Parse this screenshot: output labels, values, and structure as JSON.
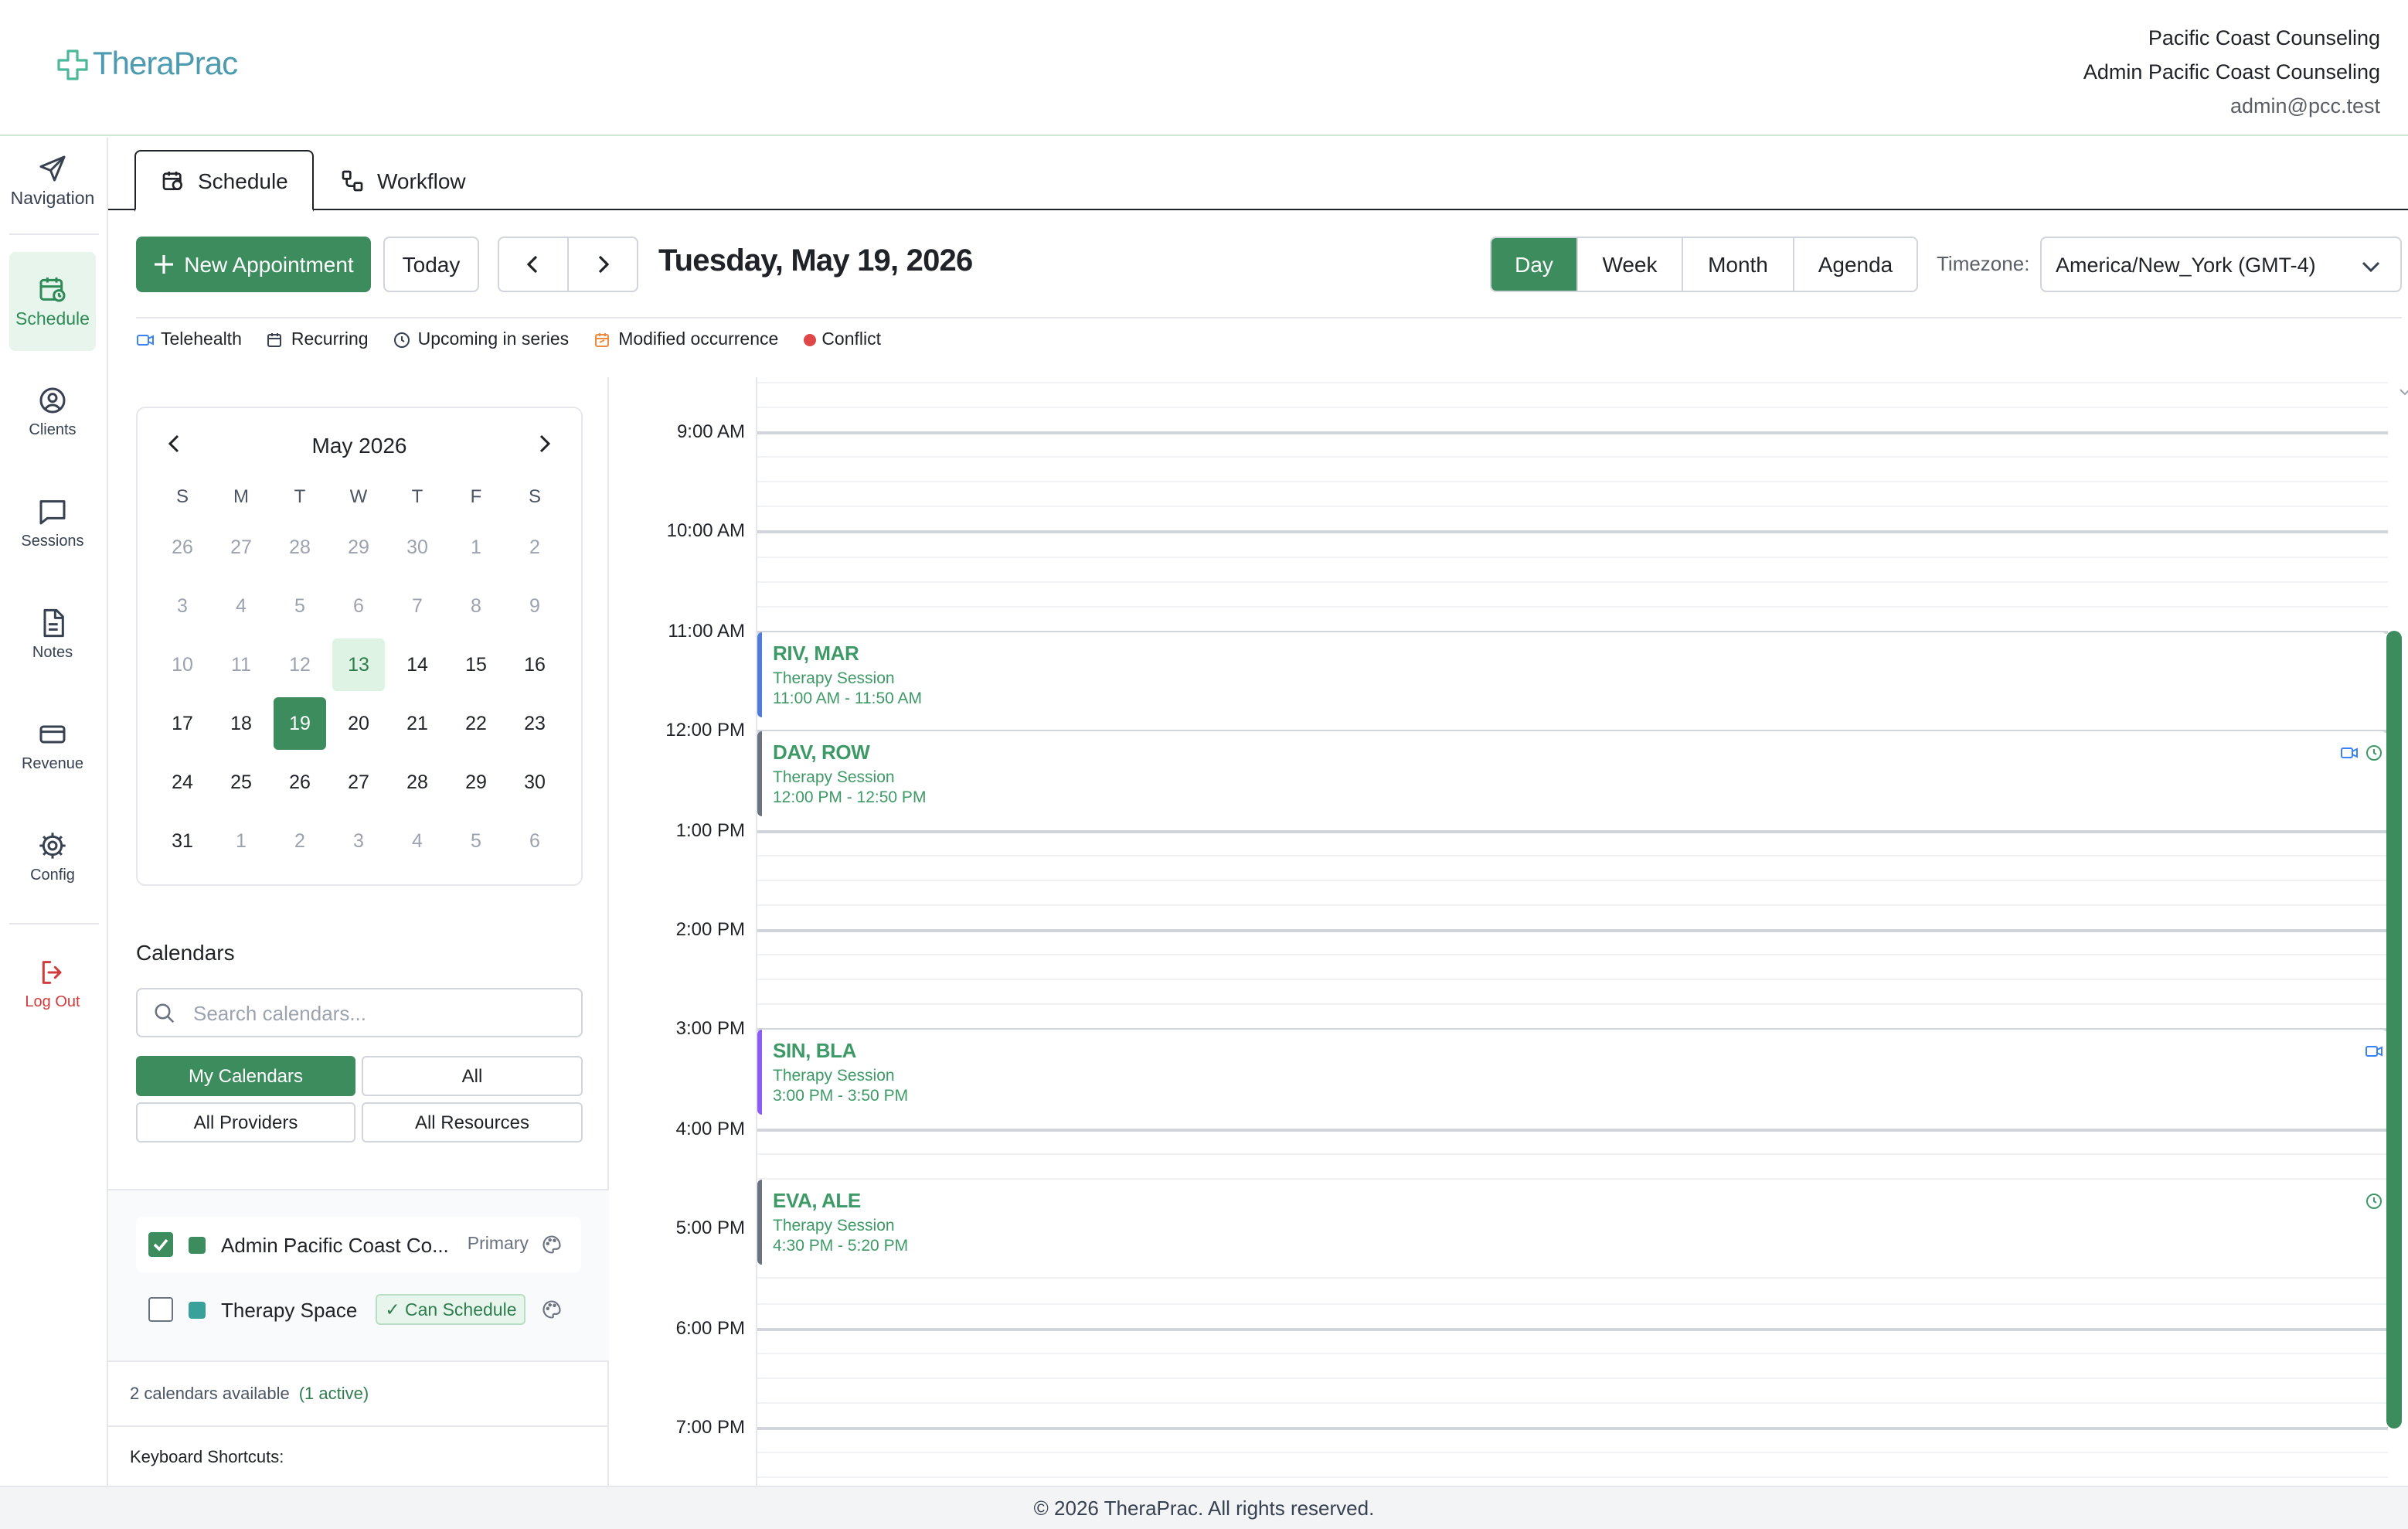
{
  "app": {
    "logo_text": "TheraPrac"
  },
  "user": {
    "org": "Pacific Coast Counseling",
    "name": "Admin Pacific Coast Counseling",
    "email": "admin@pcc.test"
  },
  "sidebar": {
    "items": [
      {
        "label": "Navigation",
        "icon": "send-icon"
      },
      {
        "label": "Schedule",
        "icon": "calendar-clock-icon"
      },
      {
        "label": "Clients",
        "icon": "user-circle-icon"
      },
      {
        "label": "Sessions",
        "icon": "message-square-icon"
      },
      {
        "label": "Notes",
        "icon": "file-text-icon"
      },
      {
        "label": "Revenue",
        "icon": "credit-card-icon"
      },
      {
        "label": "Config",
        "icon": "gear-icon"
      },
      {
        "label": "Log Out",
        "icon": "logout-icon"
      }
    ]
  },
  "tabs": [
    {
      "label": "Schedule",
      "active": true
    },
    {
      "label": "Workflow",
      "active": false
    }
  ],
  "toolbar": {
    "new_appointment": "New Appointment",
    "today": "Today",
    "date_title": "Tuesday, May 19, 2026",
    "views": [
      "Day",
      "Week",
      "Month",
      "Agenda"
    ],
    "active_view": "Day",
    "timezone_label": "Timezone:",
    "timezone_value": "America/New_York (GMT-4)"
  },
  "legend": [
    "Telehealth",
    "Recurring",
    "Upcoming in series",
    "Modified occurrence",
    "Conflict"
  ],
  "minical": {
    "title": "May 2026",
    "dow": [
      "S",
      "M",
      "T",
      "W",
      "T",
      "F",
      "S"
    ],
    "weeks": [
      [
        "26",
        "27",
        "28",
        "29",
        "30",
        "1",
        "2"
      ],
      [
        "3",
        "4",
        "5",
        "6",
        "7",
        "8",
        "9"
      ],
      [
        "10",
        "11",
        "12",
        "13",
        "14",
        "15",
        "16"
      ],
      [
        "17",
        "18",
        "19",
        "20",
        "21",
        "22",
        "23"
      ],
      [
        "24",
        "25",
        "26",
        "27",
        "28",
        "29",
        "30"
      ],
      [
        "31",
        "1",
        "2",
        "3",
        "4",
        "5",
        "6"
      ]
    ],
    "today": "13",
    "selected": "19"
  },
  "calendars": {
    "heading": "Calendars",
    "search_placeholder": "Search calendars...",
    "filters": [
      "My Calendars",
      "All",
      "All Providers",
      "All Resources"
    ],
    "active_filter": "My Calendars",
    "list": [
      {
        "name": "Admin Pacific Coast Co...",
        "tag": "Primary",
        "checked": true,
        "color": "#3d8c5e"
      },
      {
        "name": "Therapy Space",
        "tag": "✓ Can Schedule",
        "checked": false,
        "color": "#3aa09a"
      }
    ],
    "count_text": "2 calendars available",
    "active_text": "(1 active)",
    "shortcuts_label": "Keyboard Shortcuts:"
  },
  "day_view": {
    "hours": [
      "9:00 AM",
      "10:00 AM",
      "11:00 AM",
      "12:00 PM",
      "1:00 PM",
      "2:00 PM",
      "3:00 PM",
      "4:00 PM",
      "5:00 PM",
      "6:00 PM",
      "7:00 PM"
    ],
    "events": [
      {
        "name": "RIV, MAR",
        "type": "Therapy Session",
        "time": "11:00 AM - 11:50 AM",
        "accent": "#4f7bd9",
        "icons": []
      },
      {
        "name": "DAV, ROW",
        "type": "Therapy Session",
        "time": "12:00 PM - 12:50 PM",
        "accent": "#6b7280",
        "icons": [
          "video-icon",
          "clock-icon"
        ]
      },
      {
        "name": "SIN, BLA",
        "type": "Therapy Session",
        "time": "3:00 PM - 3:50 PM",
        "accent": "#8b5cf6",
        "icons": [
          "video-icon"
        ]
      },
      {
        "name": "EVA, ALE",
        "type": "Therapy Session",
        "time": "4:30 PM - 5:20 PM",
        "accent": "#6b7280",
        "icons": [
          "clock-icon"
        ]
      }
    ]
  },
  "footer": {
    "text": "© 2026 TheraPrac. All rights reserved."
  }
}
